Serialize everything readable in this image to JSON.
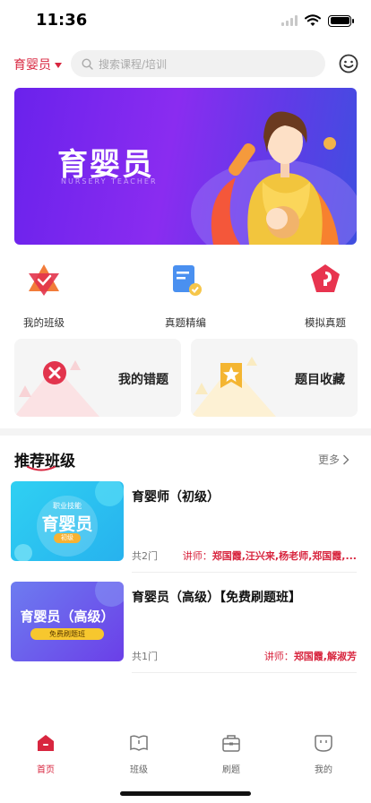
{
  "status": {
    "time": "11:36"
  },
  "header": {
    "role_label": "育婴员",
    "search_placeholder": "搜索课程/培训"
  },
  "banner": {
    "title": "育婴员",
    "subtitle": "NURSERY TEACHER"
  },
  "quick_links": [
    {
      "label": "我的班级",
      "icon": "class-badge-icon"
    },
    {
      "label": "真题精编",
      "icon": "scroll-document-icon"
    },
    {
      "label": "模拟真题",
      "icon": "mock-exam-icon"
    }
  ],
  "cards": [
    {
      "label": "我的错题",
      "icon": "wrong-x-icon"
    },
    {
      "label": "题目收藏",
      "icon": "star-bookmark-icon"
    }
  ],
  "section": {
    "title": "推荐班级",
    "more": "更多"
  },
  "courses": [
    {
      "name": "育婴师（初级）",
      "count": "共2门",
      "teacher_prefix": "讲师：",
      "teachers": "郑国霞,汪兴来,杨老师,郑国霞,...",
      "thumb_tag": "职业技能",
      "thumb_title": "育婴员",
      "thumb_badge": "初级"
    },
    {
      "name": "育婴员（高级）【免费刷题班】",
      "count": "共1门",
      "teacher_prefix": "讲师：",
      "teachers": "郑国霞,解淑芳",
      "thumb_title": "育婴员（高级）",
      "thumb_badge": "免费刷题班"
    }
  ],
  "tabs": [
    {
      "label": "首页",
      "icon": "home-icon",
      "active": true
    },
    {
      "label": "班级",
      "icon": "book-icon",
      "active": false
    },
    {
      "label": "刷题",
      "icon": "briefcase-icon",
      "active": false
    },
    {
      "label": "我的",
      "icon": "profile-icon",
      "active": false
    }
  ],
  "colors": {
    "accent": "#d8263f",
    "banner": "#7a2cef"
  }
}
